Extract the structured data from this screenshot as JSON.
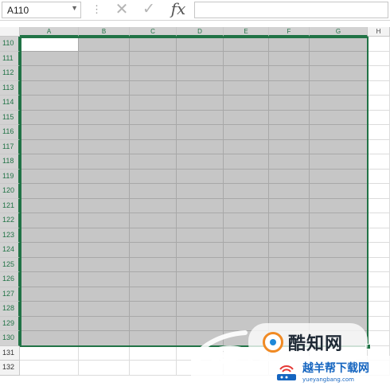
{
  "formula_bar": {
    "name_box": "A110",
    "separator": "⋮",
    "cancel_glyph": "✕",
    "enter_glyph": "✓",
    "fx_label": "fx",
    "formula_value": ""
  },
  "columns": [
    "A",
    "B",
    "C",
    "D",
    "E",
    "F",
    "G",
    "H"
  ],
  "selected_columns": [
    "A",
    "B",
    "C",
    "D",
    "E",
    "F",
    "G"
  ],
  "rows": [
    "110",
    "111",
    "112",
    "113",
    "114",
    "115",
    "116",
    "117",
    "118",
    "119",
    "120",
    "121",
    "122",
    "123",
    "124",
    "125",
    "126",
    "127",
    "128",
    "129",
    "130",
    "131",
    "132"
  ],
  "selected_rows": {
    "first": "110",
    "last": "130"
  },
  "active_cell": "A110",
  "colors": {
    "selection_border": "#217346",
    "selection_fill": "#c6c6c6",
    "header_fill": "#f3f3f3"
  },
  "watermarks": {
    "top_text": "酷知网",
    "bottom_text": "越羊帮下载网",
    "bottom_url": "yueyangbang.com"
  },
  "icons": {
    "name_box_arrow": "chevron-down-icon",
    "cancel": "close-icon",
    "enter": "check-icon",
    "fx": "function-icon"
  }
}
